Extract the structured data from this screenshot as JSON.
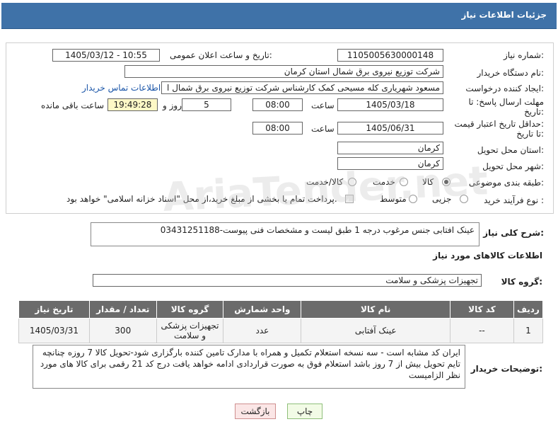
{
  "header": {
    "title": "جزئیات اطلاعات نیاز"
  },
  "form": {
    "need_number_label": "شماره نیاز:",
    "need_number": "1105005630000148",
    "announce_label": "تاریخ و ساعت اعلان عمومی:",
    "announce_value": "1405/03/12 - 10:55",
    "buyer_org_label": "نام دستگاه خریدار:",
    "buyer_org": "شرکت توزیع نیروی برق شمال استان کرمان",
    "requester_label": "ایجاد کننده درخواست:",
    "requester": "مسعود شهریاری کله مسیحی کمک کارشناس شرکت توزیع نیروی برق شمال ا",
    "contact_link": "اطلاعات تماس خریدار",
    "reply_deadline_label_1": "مهلت ارسال پاسخ: تا",
    "reply_deadline_label_2": "تاریخ:",
    "reply_date": "1405/03/18",
    "time_label": "ساعت",
    "reply_time": "08:00",
    "days_value": "5",
    "days_label": "روز و",
    "remaining_time": "19:49:28",
    "remaining_label": "ساعت باقی مانده",
    "price_validity_label_1": "حداقل تاریخ اعتبار قیمت:",
    "price_validity_label_2": "تا تاریخ:",
    "price_date": "1405/06/31",
    "price_time": "08:00",
    "province_label": "استان محل تحویل:",
    "province": "کرمان",
    "city_label": "شهر محل تحویل:",
    "city": "کرمان",
    "category_label": "طبقه بندی موضوعی:",
    "category_options": [
      "کالا",
      "خدمت",
      "کالا/خدمت"
    ],
    "process_label": "نوع فرآیند خرید :",
    "process_options": [
      "جزیی",
      "متوسط"
    ],
    "payment_note": "پرداخت تمام یا بخشی از مبلغ خرید،از محل \"اسناد خزانه اسلامی\" خواهد بود."
  },
  "summary": {
    "label": "شرح کلی نیاز:",
    "text": "عینک افتابی جنس مرغوب درجه 1 طبق لیست و مشخصات فنی پیوست-03431251188"
  },
  "goods_info_title": "اطلاعات کالاهای مورد نیاز",
  "goods_group": {
    "label": "گروه کالا:",
    "value": "تجهیزات پزشکی و سلامت"
  },
  "table": {
    "headers": [
      "ردیف",
      "کد کالا",
      "نام کالا",
      "واحد شمارش",
      "گروه کالا",
      "تعداد / مقدار",
      "تاریخ نیاز"
    ],
    "rows": [
      [
        "1",
        "--",
        "عینک آفتابی",
        "عدد",
        "تجهیزات پزشکی و سلامت",
        "300",
        "1405/03/31"
      ]
    ]
  },
  "buyer_notes": {
    "label": "توضیحات خریدار:",
    "text": "ایران کد مشابه است - سه نسخه استعلام تکمیل و همراه با مدارک تامین کننده بارگزاری شود-تحویل کالا 7 روزه چنانچه تایم تحویل بیش از 7 روز باشد استعلام فوق به صورت قراردادی ادامه خواهد یافت  درج کد 21 رقمی برای کالا های مورد نظر الزامیست"
  },
  "buttons": {
    "print": "چاپ",
    "back": "بازگشت"
  },
  "watermark": "AriaTender.net"
}
